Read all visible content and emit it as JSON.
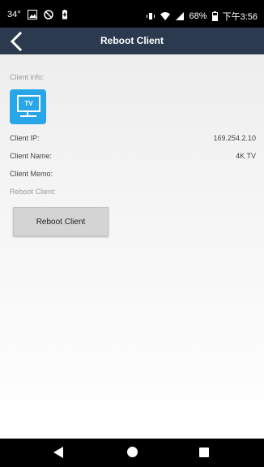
{
  "status_bar": {
    "temperature": "34°",
    "battery_percent": "68%",
    "time": "下午3:56",
    "icons": [
      "image-icon",
      "sync-icon",
      "battery-saver-icon",
      "vibrate-icon",
      "wifi-icon",
      "signal-icon",
      "battery-icon"
    ]
  },
  "header": {
    "title": "Reboot Client",
    "back_icon": "chevron-left-icon"
  },
  "client_info": {
    "section_label": "Client info:",
    "device_icon_text": "TV",
    "rows": [
      {
        "label": "Client IP:",
        "value": "169.254.2.10"
      },
      {
        "label": "Client Name:",
        "value": "4K TV"
      },
      {
        "label": "Client Memo:",
        "value": ""
      }
    ]
  },
  "reboot": {
    "section_label": "Reboot Client:",
    "button_label": "Reboot Client"
  },
  "nav_bar": {
    "icons": [
      "back-triangle-icon",
      "home-circle-icon",
      "recents-square-icon"
    ]
  },
  "colors": {
    "header_bg": "#2b3a4e",
    "icon_blue": "#29a6e8",
    "button_bg": "#d4d4d4"
  }
}
